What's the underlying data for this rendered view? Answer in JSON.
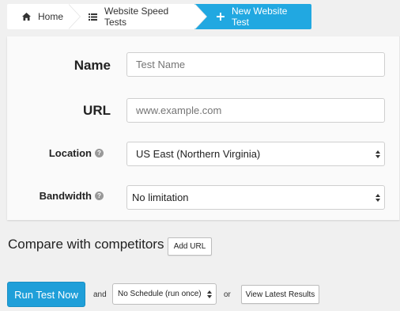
{
  "breadcrumb": {
    "home": "Home",
    "tests": "Website Speed Tests",
    "current": "New Website Test"
  },
  "form": {
    "name_label": "Name",
    "name_placeholder": "Test Name",
    "url_label": "URL",
    "url_placeholder": "www.example.com",
    "location_label": "Location",
    "location_value": "US East (Northern Virginia)",
    "bandwidth_label": "Bandwidth",
    "bandwidth_value": "No limitation",
    "help_glyph": "?"
  },
  "compare": {
    "title": "Compare with competitors",
    "add_url": "Add URL"
  },
  "actions": {
    "run": "Run Test Now",
    "and": "and",
    "schedule_value": "No Schedule (run once)",
    "or": "or",
    "view_results": "View Latest Results"
  },
  "colors": {
    "accent": "#21a8e1",
    "primary_button": "#1f9fd9"
  },
  "icons": {
    "home": "home-icon",
    "list": "list-icon",
    "plus": "plus-icon",
    "help": "question-circle-icon",
    "select": "sort-arrows-icon"
  }
}
